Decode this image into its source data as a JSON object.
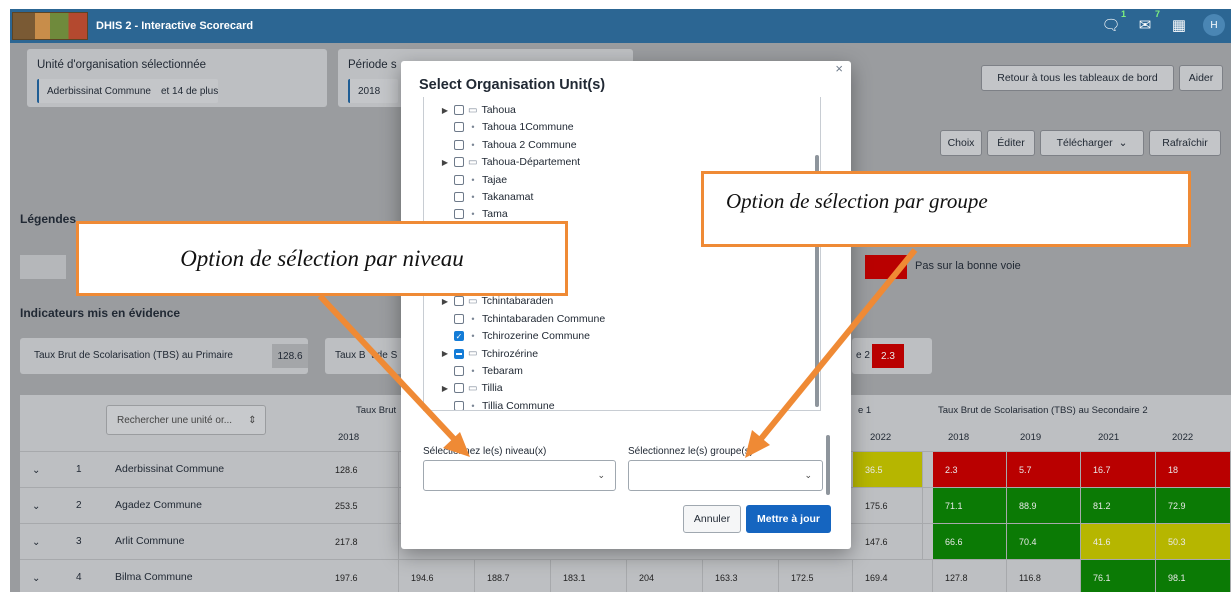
{
  "app": {
    "title": "DHIS 2 - Interactive Scorecard",
    "profile_initial": "H",
    "notif_interpretations": "1",
    "notif_messages": "7"
  },
  "org_card": {
    "label": "Unité d'organisation sélectionnée",
    "value": "Aderbissinat Commune",
    "more": "et 14 de plus"
  },
  "period_card": {
    "label": "Période s",
    "value": "2018"
  },
  "header_buttons": {
    "back": "Retour à tous les tableaux de bord",
    "help": "Aider"
  },
  "toolbar": {
    "choice": "Choix",
    "edit": "Éditer",
    "download": "Télécharger",
    "refresh": "Rafraîchir"
  },
  "legend": {
    "title": "Légendes",
    "off_track": "Pas sur la bonne voie"
  },
  "highlighted": {
    "title": "Indicateurs mis en évidence",
    "ind1_label": "Taux Brut de Scolarisation (TBS) au Primaire",
    "ind1_value": "128.6",
    "ind2_partial": "Taux B  t de S",
    "ind3_partial": "e 2",
    "ind3_value": "2.3"
  },
  "table": {
    "search_placeholder": "Rechercher une unité or...",
    "header_group_1": "Taux Brut",
    "header_group_2": "e 1",
    "header_group_3": "Taux Brut de Scolarisation (TBS) au Secondaire 2",
    "year_2018": "2018",
    "year_2019": "2019",
    "year_2021": "2021",
    "year_2022": "2022",
    "year_2022_b": "2022",
    "rows": [
      {
        "num": "1",
        "name": "Aderbissinat Commune",
        "first": "128.6",
        "mid": "36.5",
        "s2": [
          "2.3",
          "5.7",
          "16.7",
          "18"
        ]
      },
      {
        "num": "2",
        "name": "Agadez Commune",
        "first": "253.5",
        "mid": "175.6",
        "s2": [
          "71.1",
          "88.9",
          "81.2",
          "72.9"
        ]
      },
      {
        "num": "3",
        "name": "Arlit Commune",
        "first": "217.8",
        "mid": "147.6",
        "s2": [
          "66.6",
          "70.4",
          "41.6",
          "50.3"
        ]
      },
      {
        "num": "4",
        "name": "Bilma Commune",
        "first": "197.6",
        "others": [
          "194.6",
          "188.7",
          "183.1",
          "204",
          "163.3",
          "172.5"
        ],
        "mid": "169.4",
        "s2": [
          "127.8",
          "116.8",
          "76.1",
          "98.1"
        ]
      }
    ]
  },
  "modal": {
    "title": "Select Organisation Unit(s)",
    "close": "×",
    "tree": [
      {
        "label": "Tahoua",
        "kind": "folder",
        "state": "none"
      },
      {
        "label": "Tahoua 1Commune",
        "kind": "leaf",
        "state": "none"
      },
      {
        "label": "Tahoua 2 Commune",
        "kind": "leaf",
        "state": "none"
      },
      {
        "label": "Tahoua-Département",
        "kind": "folder",
        "state": "none"
      },
      {
        "label": "Tajae",
        "kind": "leaf",
        "state": "none"
      },
      {
        "label": "Takanamat",
        "kind": "leaf",
        "state": "none"
      },
      {
        "label": "Tama",
        "kind": "leaf",
        "state": "none"
      },
      {
        "label": "",
        "kind": "hidden",
        "state": "none"
      },
      {
        "label": "",
        "kind": "hidden",
        "state": "none"
      },
      {
        "label": "",
        "kind": "hidden",
        "state": "none"
      },
      {
        "label": "e",
        "kind": "hidden",
        "state": "none"
      },
      {
        "label": "Tchintabaraden",
        "kind": "folder",
        "state": "none"
      },
      {
        "label": "Tchintabaraden Commune",
        "kind": "leaf",
        "state": "none"
      },
      {
        "label": "Tchirozerine Commune",
        "kind": "leaf",
        "state": "checked"
      },
      {
        "label": "Tchirozérine",
        "kind": "folder",
        "state": "partial"
      },
      {
        "label": "Tebaram",
        "kind": "leaf",
        "state": "none"
      },
      {
        "label": "Tillia",
        "kind": "folder",
        "state": "none"
      },
      {
        "label": "Tillia Commune",
        "kind": "leaf",
        "state": "none"
      }
    ],
    "level_label": "Sélectionnez le(s) niveau(x)",
    "group_label": "Sélectionnez le(s) groupe(s)",
    "cancel": "Annuler",
    "update": "Mettre à jour"
  },
  "callouts": {
    "level": "Option de sélection par niveau",
    "group": "Option de sélection par groupe"
  },
  "colors": {
    "topbar": "#2c6693",
    "red": "#b90000",
    "green": "#0b7a05",
    "yellow": "#b6b600",
    "primary": "#1565c0",
    "callout_border": "#ef8a35"
  }
}
